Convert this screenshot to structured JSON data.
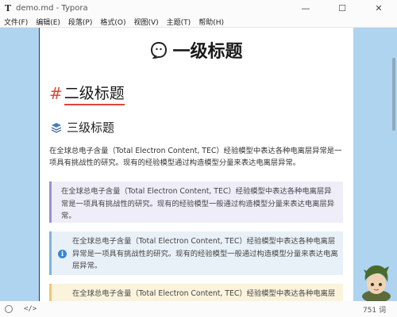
{
  "window": {
    "title": "demo.md - Typora",
    "app_icon": "T",
    "minimize": "—",
    "maximize": "☐",
    "close": "✕"
  },
  "menu": [
    "文件(F)",
    "编辑(E)",
    "段落(P)",
    "格式(O)",
    "视图(V)",
    "主题(T)",
    "帮助(H)"
  ],
  "doc": {
    "h1": "一级标题",
    "h2_hash": "#",
    "h2": "二级标题",
    "h3": "三级标题",
    "paragraph": "在全球总电子含量（Total Electron Content, TEC）经验模型中表达各种电离层异常是一项具有挑战性的研究。现有的经验模型通过构造模型分量来表达电离层异常。",
    "callout_purple": "在全球总电子含量（Total Electron Content, TEC）经验模型中表达各种电离层异常是一项具有挑战性的研究。现有的经验模型一般通过构造模型分量来表达电离层异常。",
    "callout_blue": "在全球总电子含量（Total Electron Content, TEC）经验模型中表达各种电离层异常是一项具有挑战性的研究。现有的经验模型一般通过构造模型分量来表达电离层异常。",
    "callout_yellow": "在全球总电子含量（Total Electron Content, TEC）经验模型中表达各种电离层异常是一项具有挑战性的研究。"
  },
  "status": {
    "source_toggle": "</>",
    "word_count": "751 词"
  },
  "colors": {
    "h2_accent": "#e0453a",
    "callout_purple": "#9b8fd8",
    "callout_blue": "#7fb2e0",
    "callout_yellow": "#efc86b",
    "background": "#aed4ef"
  }
}
